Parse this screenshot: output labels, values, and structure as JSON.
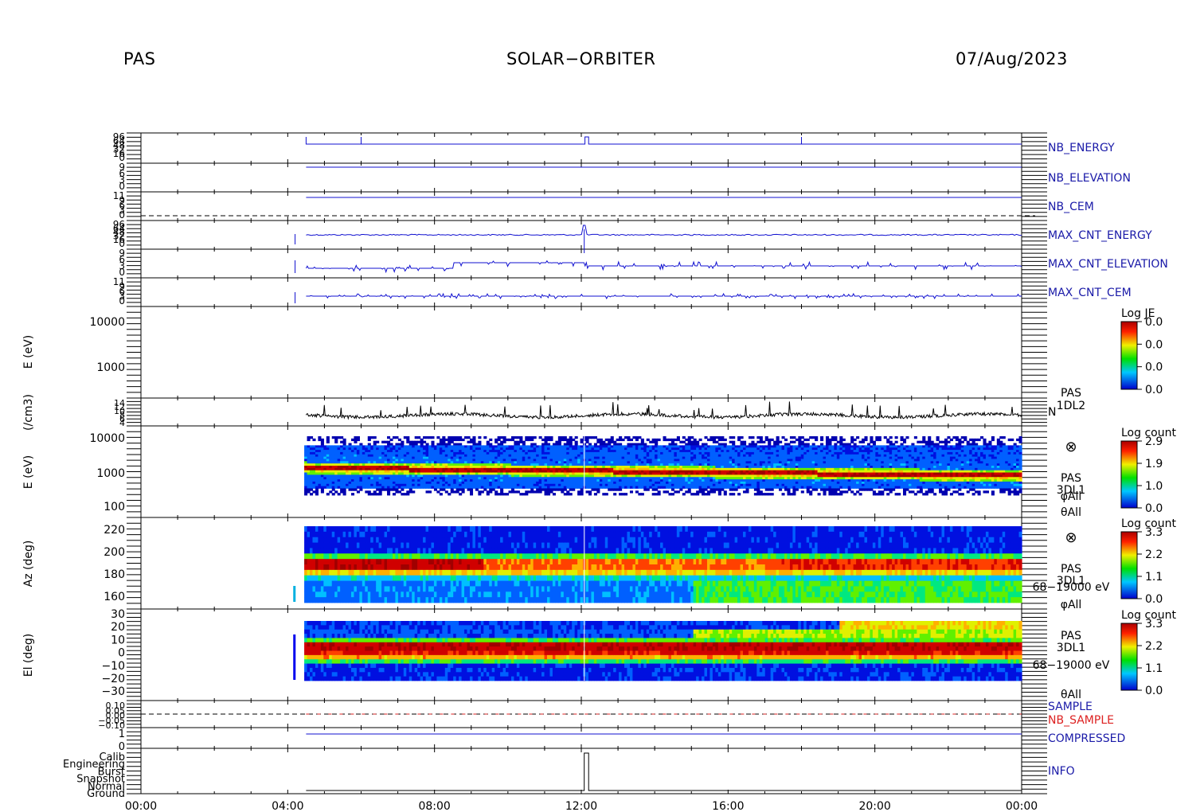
{
  "header": {
    "instrument": "PAS",
    "mission": "SOLAR−ORBITER",
    "date": "07/Aug/2023"
  },
  "time_axis": {
    "ticks": [
      "00:00",
      "04:00",
      "08:00",
      "12:00",
      "16:00",
      "20:00",
      "00:00"
    ],
    "range_hours": [
      0,
      24
    ]
  },
  "colors": {
    "label_blue": "#1a1aa8",
    "label_red": "#dd2222",
    "trace_blue": "#1010d0",
    "trace_black": "#000000"
  },
  "panels": {
    "nb_energy": {
      "name": "NB_ENERGY",
      "tick_labels": [
        "96",
        "64",
        "48",
        "32",
        "16",
        "0"
      ]
    },
    "nb_elevation": {
      "name": "NB_ELEVATION",
      "tick_labels": [
        "9",
        "6",
        "3",
        "0"
      ]
    },
    "nb_cem": {
      "name": "NB_CEM",
      "tick_labels": [
        "11",
        "9",
        "6",
        "3",
        "0"
      ]
    },
    "max_cnt_energy": {
      "name": "MAX_CNT_ENERGY",
      "tick_labels": [
        "96",
        "64",
        "48",
        "32",
        "16",
        "0"
      ]
    },
    "max_cnt_elevation": {
      "name": "MAX_CNT_ELEVATION",
      "tick_labels": [
        "9",
        "6",
        "3",
        "0"
      ]
    },
    "max_cnt_cem": {
      "name": "MAX_CNT_CEM",
      "tick_labels": [
        "11",
        "9",
        "6",
        "3",
        "0"
      ]
    },
    "energy_1": {
      "ylabel": "E (eV)",
      "tick_labels": [
        "10000",
        "1000"
      ],
      "colorbar": {
        "title": "Log JE",
        "ticks": [
          "0.0",
          "0.0",
          "0.0",
          "0.0"
        ]
      }
    },
    "density": {
      "ylabel": "(/cm3)",
      "tick_labels": [
        "14",
        "12",
        "10",
        "8",
        "6",
        "4"
      ],
      "side_labels": [
        "PAS",
        "1DL2",
        "N"
      ]
    },
    "energy_2": {
      "ylabel": "E (eV)",
      "tick_labels": [
        "10000",
        "1000",
        "100"
      ],
      "side_labels": [
        "⊗",
        "PAS",
        "3DL1",
        "φAll",
        "θAll"
      ],
      "colorbar": {
        "title": "Log count",
        "ticks": [
          "2.9",
          "1.9",
          "1.0",
          "0.0"
        ]
      }
    },
    "azimuth": {
      "ylabel": "Az (deg)",
      "tick_labels": [
        "220",
        "200",
        "180",
        "160"
      ],
      "side_labels": [
        "⊗",
        "PAS",
        "3DL1",
        "68−19000 eV",
        "φAll"
      ],
      "colorbar": {
        "title": "Log count",
        "ticks": [
          "3.3",
          "2.2",
          "1.1",
          "0.0"
        ]
      }
    },
    "elevation": {
      "ylabel": "El (deg)",
      "tick_labels": [
        "30",
        "20",
        "10",
        "0",
        "−10",
        "−20",
        "−30"
      ],
      "side_labels": [
        "PAS",
        "3DL1",
        "68−19000 eV",
        "θAll"
      ],
      "colorbar": {
        "title": "Log count",
        "ticks": [
          "3.3",
          "2.2",
          "1.1",
          "0.0"
        ]
      }
    },
    "sample": {
      "names": [
        "SAMPLE",
        "NB_SAMPLE"
      ],
      "tick_labels": [
        "0.10",
        "0.05",
        "0.00",
        "−0.05",
        "−0.10"
      ]
    },
    "compressed": {
      "name": "COMPRESSED",
      "tick_labels": [
        "1",
        "0"
      ]
    },
    "info": {
      "name": "INFO",
      "tick_labels": [
        "Calib",
        "Engineering",
        "Burst",
        "Snapshot",
        "Normal",
        "Ground"
      ]
    }
  },
  "chart_data": {
    "type": "heatmap",
    "title": "SOLAR−ORBITER",
    "x_unit": "UT hours",
    "xlim": [
      0,
      24
    ],
    "data_start_hour": 4.5,
    "density_series": {
      "typical_range": [
        6,
        10
      ]
    },
    "energy_spectrogram": {
      "ylim_eV": [
        100,
        10000
      ],
      "peak_band_eV": [
        900,
        1200
      ]
    },
    "azimuth_spectrogram": {
      "ylim_deg": [
        150,
        225
      ],
      "peak_band_deg": [
        176,
        192
      ]
    },
    "elevation_spectrogram": {
      "ylim_deg": [
        -30,
        30
      ],
      "peak_band_deg": [
        -8,
        6
      ]
    }
  }
}
